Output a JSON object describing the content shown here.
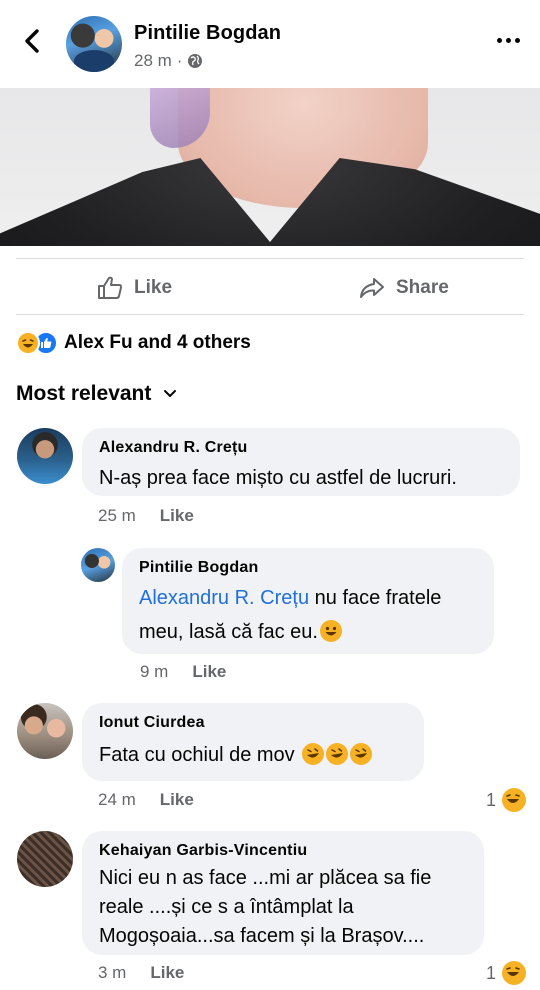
{
  "header": {
    "author": "Pintilie Bogdan",
    "time": "28 m",
    "separator": "·",
    "privacy_icon": "globe-icon"
  },
  "actions": {
    "like_label": "Like",
    "share_label": "Share"
  },
  "reactions": {
    "icons": [
      "haha-reaction-icon",
      "like-reaction-icon"
    ],
    "summary": "Alex Fu and 4 others"
  },
  "sort": {
    "label": "Most relevant"
  },
  "comments": [
    {
      "author": "Alexandru R. Crețu",
      "text": "N-aș prea face mișto cu astfel de lucruri.",
      "time": "25 m",
      "like_label": "Like"
    },
    {
      "author": "Pintilie Bogdan",
      "mention": "Alexandru R. Crețu",
      "text": " nu face fratele meu, lasă că fac eu.",
      "time": "9 m",
      "like_label": "Like",
      "is_reply": true
    },
    {
      "author": "Ionut Ciurdea",
      "text": "Fata cu ochiul de mov ",
      "time": "24 m",
      "like_label": "Like",
      "reaction_count": "1"
    },
    {
      "author": "Kehaiyan Garbis-Vincentiu",
      "text": "Nici eu n as face ...mi ar plăcea sa fie reale ....și ce s a întâmplat la Mogoșoaia...sa facem și la Brașov....",
      "time": "3 m",
      "like_label": "Like",
      "reaction_count": "1"
    }
  ],
  "colors": {
    "link": "#216fdb",
    "muted": "#65676b",
    "bubble": "#f0f2f5",
    "like_blue": "#1877f2",
    "haha_yellow": "#f7b125"
  }
}
